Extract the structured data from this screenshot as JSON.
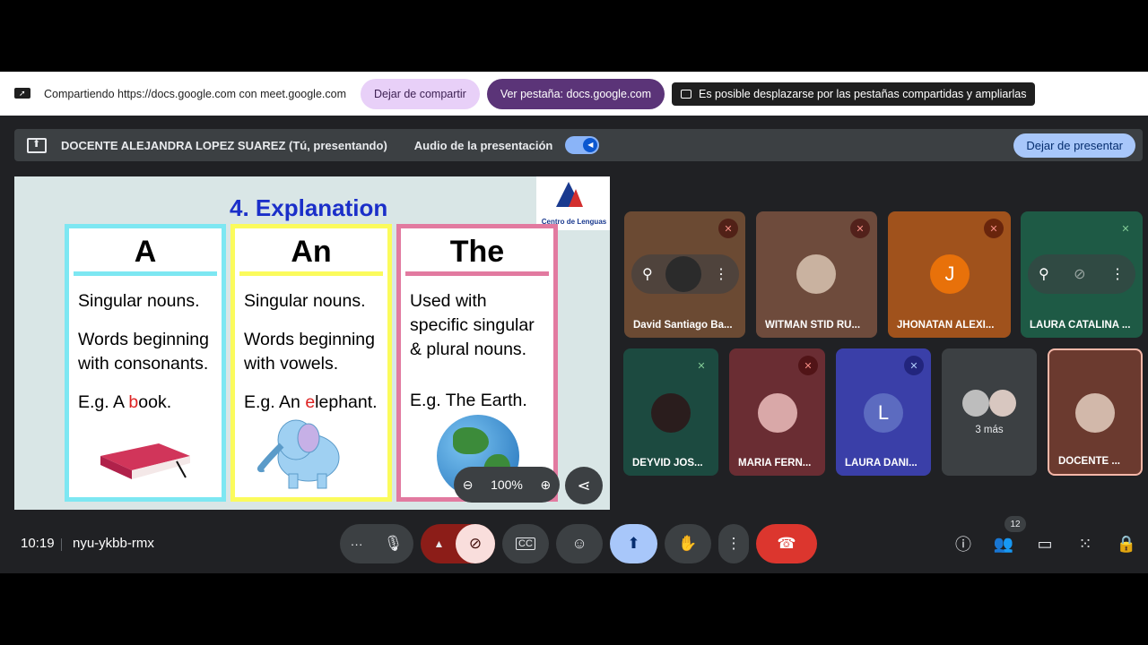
{
  "share_bar": {
    "text": "Compartiendo https://docs.google.com con meet.google.com",
    "stop_label": "Dejar de compartir",
    "view_tab_label": "Ver pestaña: docs.google.com",
    "tip_text": "Es posible desplazarse por las pestañas compartidas y ampliarlas"
  },
  "presenting_bar": {
    "presenter": "DOCENTE ALEJANDRA LOPEZ SUAREZ (Tú, presentando)",
    "audio_label": "Audio de la presentación",
    "stop_label": "Dejar de presentar"
  },
  "slide": {
    "title": "4. Explanation",
    "logo_text": "Centro de Lenguas",
    "zoom": "100%",
    "cards": [
      {
        "head": "A",
        "lines": [
          "Singular nouns.",
          "Words beginning with consonants."
        ],
        "eg_prefix": "E.g. A ",
        "eg_red": "b",
        "eg_suffix": "ook."
      },
      {
        "head": "An",
        "lines": [
          "Singular nouns.",
          "Words beginning with vowels."
        ],
        "eg_prefix": "E.g. An ",
        "eg_red": "e",
        "eg_suffix": "lephant."
      },
      {
        "head": "The",
        "lines": [
          "Used with specific singular & plural nouns."
        ],
        "eg_prefix": "E.g. The Earth.",
        "eg_red": "",
        "eg_suffix": ""
      }
    ]
  },
  "participants": [
    {
      "name": "David Santiago Ba...",
      "status": "muted",
      "color": "#6b4a33"
    },
    {
      "name": "WITMAN STID RU...",
      "status": "muted",
      "color": "#6e4b3c"
    },
    {
      "name": "JHONATAN ALEXI...",
      "letter": "J",
      "status": "muted",
      "color": "#a0521c"
    },
    {
      "name": "LAURA CATALINA ...",
      "status": "speaking",
      "color": "#1e5a45"
    },
    {
      "name": "DEYVID JOS...",
      "status": "speaking",
      "color": "#1c4a40"
    },
    {
      "name": "MARIA FERN...",
      "status": "muted",
      "color": "#6a2d33"
    },
    {
      "name": "LAURA DANI...",
      "letter": "L",
      "status": "muted",
      "color": "#3a3fa8"
    },
    {
      "more_label": "3 más",
      "color": "#3c4043"
    },
    {
      "name": "DOCENTE ...",
      "color": "#6b3a2f"
    }
  ],
  "bottom_bar": {
    "time": "10:19",
    "meeting_code": "nyu-ykbb-rmx",
    "participant_count": "12"
  }
}
